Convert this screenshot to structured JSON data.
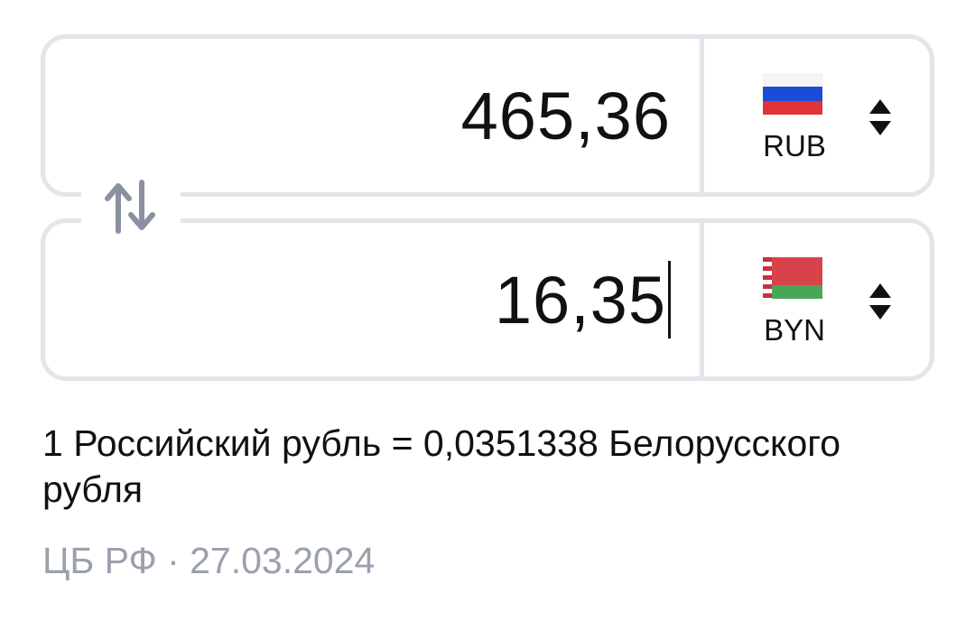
{
  "converter": {
    "from": {
      "amount": "465,36",
      "currency_code": "RUB",
      "flag_icon": "russia-flag-icon"
    },
    "to": {
      "amount": "16,35",
      "currency_code": "BYN",
      "flag_icon": "belarus-flag-icon"
    },
    "swap_icon": "swap-arrows-icon",
    "selector_icon": "sort-arrows-icon"
  },
  "rate": {
    "text": "1 Российский рубль = 0,0351338 Белорусского рубля"
  },
  "source": {
    "text": "ЦБ РФ · 27.03.2024"
  },
  "colors": {
    "border": "#e4e4ea",
    "icon_gray": "#8a91a0",
    "muted_text": "#9aa0ad"
  }
}
